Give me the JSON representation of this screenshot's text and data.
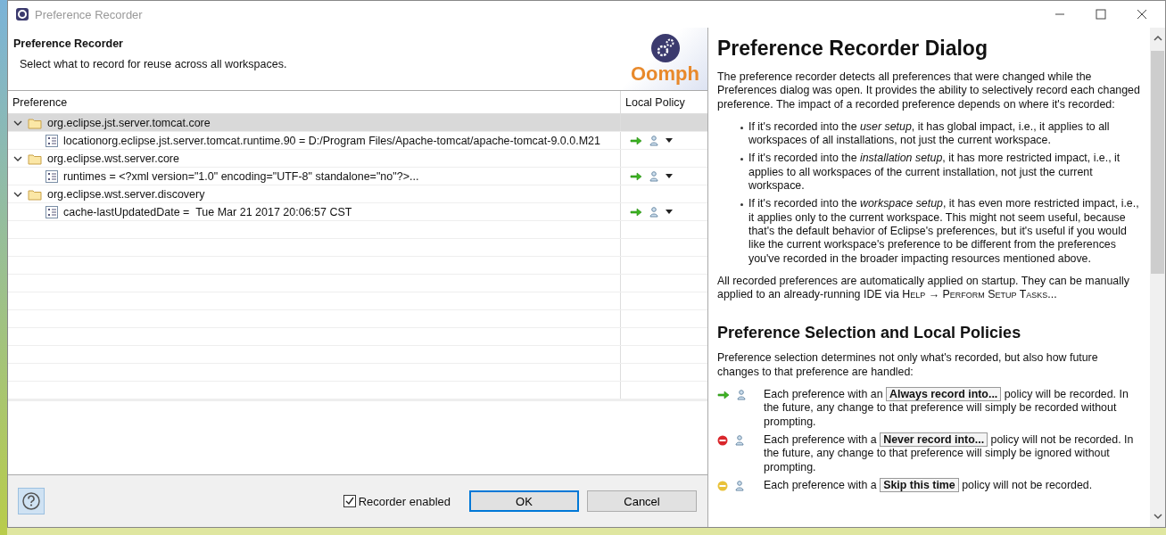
{
  "window": {
    "title": "Preference Recorder"
  },
  "header": {
    "title": "Preference Recorder",
    "subtitle": "Select what to record for reuse across all workspaces.",
    "logo_text": "Oomph"
  },
  "table": {
    "columns": [
      "Preference",
      "Local Policy"
    ],
    "rows": [
      {
        "label": "org.eclipse.jst.server.tomcat.core",
        "expanded": true,
        "selected": true,
        "children": [
          {
            "label": "locationorg.eclipse.jst.server.tomcat.runtime.90 = D:/Program Files/Apache-tomcat/apache-tomcat-9.0.0.M21",
            "kind": "always"
          }
        ]
      },
      {
        "label": "org.eclipse.wst.server.core",
        "expanded": true,
        "selected": false,
        "children": [
          {
            "label": "runtimes = <?xml version=\"1.0\" encoding=\"UTF-8\" standalone=\"no\"?>...",
            "kind": "always"
          }
        ]
      },
      {
        "label": "org.eclipse.wst.server.discovery",
        "expanded": true,
        "selected": false,
        "children": [
          {
            "label": "cache-lastUpdatedDate =  Tue Mar 21 2017 20:06:57 CST",
            "kind": "always"
          }
        ]
      }
    ]
  },
  "footer": {
    "recorder_enabled": {
      "label": "Recorder enabled",
      "checked": true
    },
    "buttons": [
      "OK",
      "Cancel"
    ]
  },
  "help": {
    "title": "Preference Recorder Dialog",
    "intro": "The preference recorder detects all preferences that were changed while the Preferences dialog was open. It provides the ability to selectively record each changed preference. The impact of a recorded preference depends on where it's recorded:",
    "bullets": [
      "If it's recorded into the *user setup*, it has global impact, i.e., it applies to all workspaces of all installations, not just the current workspace.",
      "If it's recorded into the *installation setup*, it has more restricted impact, i.e., it applies to all workspaces of the current installation, not just the current workspace.",
      "If it's recorded into the *workspace setup*, it has even more restricted impact, i.e., it applies only to the current workspace. This might not seem useful, because that's the default behavior of Eclipse's preferences, but it's useful if you would like the current workspace's preference to be different from the preferences you've recorded in the broader impacting resources mentioned above."
    ],
    "startup": {
      "text": "All recorded preferences are automatically applied on startup. They can be manually applied to an already-running IDE via ",
      "menu_path": "Help → Perform Setup Tasks..."
    },
    "section_title": "Preference Selection and Local Policies",
    "section_intro": "Preference selection determines not only what's recorded, but also how future changes to that preference are handled:",
    "policies": [
      {
        "kind": "always",
        "text": "Each preference with an **Always record into...** policy will be recorded. In the future, any change to that preference will simply be recorded without prompting."
      },
      {
        "kind": "never",
        "text": "Each preference with a **Never record into...** policy will not be recorded. In the future, any change to that preference will simply be ignored without prompting."
      },
      {
        "kind": "skip",
        "text": "Each preference with a **Skip this time** policy will not be recorded."
      }
    ]
  }
}
